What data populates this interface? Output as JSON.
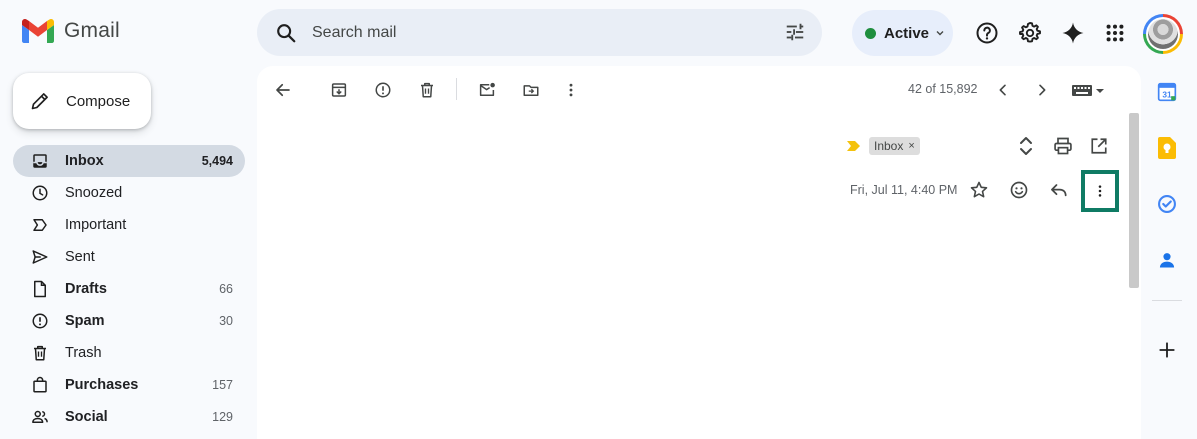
{
  "app": {
    "name": "Gmail"
  },
  "search": {
    "placeholder": "Search mail"
  },
  "status": {
    "label": "Active",
    "color": "#1e8e3e"
  },
  "compose": {
    "label": "Compose"
  },
  "nav": {
    "items": [
      {
        "label": "Inbox",
        "count": "5,494",
        "icon": "inbox-icon",
        "active": true,
        "bold": true
      },
      {
        "label": "Snoozed",
        "count": "",
        "icon": "clock-icon",
        "active": false,
        "bold": false
      },
      {
        "label": "Important",
        "count": "",
        "icon": "label-important-icon",
        "active": false,
        "bold": false
      },
      {
        "label": "Sent",
        "count": "",
        "icon": "send-icon",
        "active": false,
        "bold": false
      },
      {
        "label": "Drafts",
        "count": "66",
        "icon": "draft-icon",
        "active": false,
        "bold": true
      },
      {
        "label": "Spam",
        "count": "30",
        "icon": "report-icon",
        "active": false,
        "bold": true
      },
      {
        "label": "Trash",
        "count": "",
        "icon": "trash-icon",
        "active": false,
        "bold": false
      },
      {
        "label": "Purchases",
        "count": "157",
        "icon": "shopping-bag-icon",
        "active": false,
        "bold": true
      },
      {
        "label": "Social",
        "count": "129",
        "icon": "people-icon",
        "active": false,
        "bold": true
      }
    ]
  },
  "toolbar": {
    "pager": "42 of 15,892",
    "icons": [
      "back-arrow-icon",
      "archive-icon",
      "report-spam-icon",
      "delete-icon",
      "mark-unread-icon",
      "move-to-icon",
      "more-vert-icon",
      "chevron-left-icon",
      "chevron-right-icon",
      "keyboard-icon"
    ]
  },
  "message": {
    "label_chip": "Inbox",
    "chip_close": "×",
    "date": "Fri, Jul 11, 4:40 PM"
  },
  "colors": {
    "background": "#f8fafd",
    "active_nav": "#d3dae3",
    "search_bg": "#e9eef6",
    "highlight_box": "#0f7b64",
    "importance_marker": "#f4c20d"
  }
}
